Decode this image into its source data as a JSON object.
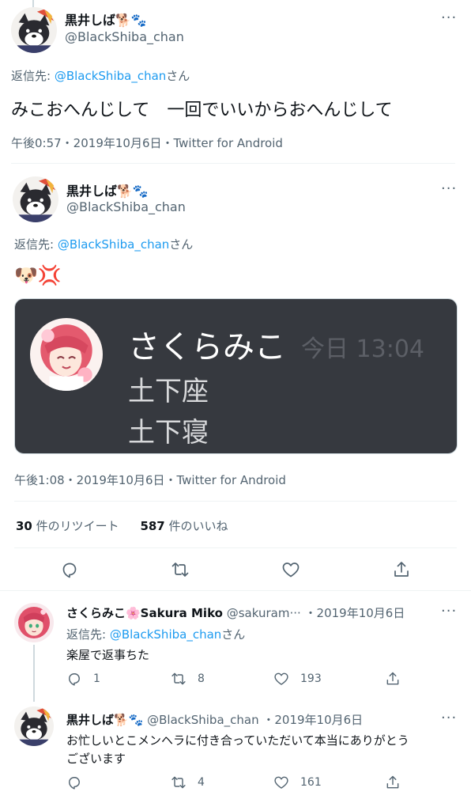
{
  "tweet1": {
    "display_name": "黒井しば🐕🐾",
    "handle": "@BlackShiba_chan",
    "reply_prefix": "返信先: ",
    "reply_to": "@BlackShiba_chan",
    "reply_suffix": "さん",
    "text": "みこおへんじして　一回でいいからおへんじして",
    "meta": "午後0:57・2019年10月6日・Twitter for Android"
  },
  "tweet2": {
    "display_name": "黒井しば🐕🐾",
    "handle": "@BlackShiba_chan",
    "reply_prefix": "返信先: ",
    "reply_to": "@BlackShiba_chan",
    "reply_suffix": "さん",
    "emoji": "🐶💢",
    "card": {
      "name": "さくらみこ",
      "time": "今日 13:04",
      "line1": "土下座",
      "line2": "土下寝"
    },
    "meta": "午後1:08・2019年10月6日・Twitter for Android",
    "stats": {
      "retweets_count": "30",
      "retweets_label": " 件のリツイート",
      "likes_count": "587",
      "likes_label": " 件のいいね"
    }
  },
  "reply1": {
    "display_name": "さくらみこ🌸Sakura Miko",
    "handle": "@sakuram···",
    "date": "・2019年10月6日",
    "reply_prefix": "返信先: ",
    "reply_to": "@BlackShiba_chan",
    "reply_suffix": "さん",
    "text": "楽屋で返事ちた",
    "replies": "1",
    "retweets": "8",
    "likes": "193"
  },
  "reply2": {
    "display_name": "黒井しば🐕🐾",
    "handle": "@BlackShiba_chan",
    "date": "・2019年10月6日",
    "text_line1": "お忙しいとこメンヘラに付き合っていただいて本当にありがとう",
    "text_line2": "ございます",
    "replies": "",
    "retweets": "4",
    "likes": "161"
  },
  "more_label": "···",
  "icons": [
    "reply-icon",
    "retweet-icon",
    "like-icon",
    "share-icon",
    "more-icon",
    "avatar-shiba",
    "avatar-miko"
  ],
  "colors": {
    "link": "#1d9bf0",
    "muted": "#536471",
    "card_bg": "#36393f"
  }
}
